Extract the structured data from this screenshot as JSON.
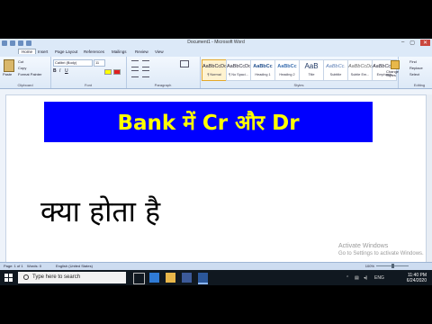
{
  "window": {
    "title": "Document1 - Microsoft Word",
    "controls": [
      "–",
      "▢",
      "✕"
    ]
  },
  "tabs": [
    "Home",
    "Insert",
    "Page Layout",
    "References",
    "Mailings",
    "Review",
    "View"
  ],
  "ribbon": {
    "clipboard": {
      "paste": "Paste",
      "cut": "Cut",
      "copy": "Copy",
      "format_painter": "Format Painter",
      "label": "Clipboard"
    },
    "font": {
      "name": "Calibri (Body)",
      "size": "11",
      "label": "Font"
    },
    "paragraph": {
      "label": "Paragraph"
    },
    "styles": {
      "items": [
        {
          "preview": "AaBbCcDc",
          "name": "¶ Normal"
        },
        {
          "preview": "AaBbCcDc",
          "name": "¶ No Spaci..."
        },
        {
          "preview": "AaBbCc",
          "name": "Heading 1"
        },
        {
          "preview": "AaBbCc",
          "name": "Heading 2"
        },
        {
          "preview": "AaB",
          "name": "Title"
        },
        {
          "preview": "AaBbCc.",
          "name": "Subtitle"
        },
        {
          "preview": "AaBbCcDc",
          "name": "Subtle Em..."
        },
        {
          "preview": "AaBbCcDc",
          "name": "Emphasis"
        }
      ],
      "change_styles": "Change Styles",
      "label": "Styles"
    },
    "editing": {
      "find": "Find",
      "replace": "Replace",
      "select": "Select",
      "label": "Editing"
    }
  },
  "document": {
    "banner_text": "Bank में  Cr और  Dr",
    "body_text": "क्या  होता  है",
    "banner_bg": "#0000ff",
    "banner_fg": "#ffff00"
  },
  "watermark": {
    "line1": "Activate Windows",
    "line2": "Go to Settings to activate Windows."
  },
  "status": {
    "page": "Page: 1 of 1",
    "words": "Words: 0",
    "language": "English (United States)",
    "zoom": "100%"
  },
  "taskbar": {
    "search_placeholder": "Type here to search",
    "lang": "ENG",
    "time": "11:40 PM",
    "date": "6/24/2020"
  }
}
